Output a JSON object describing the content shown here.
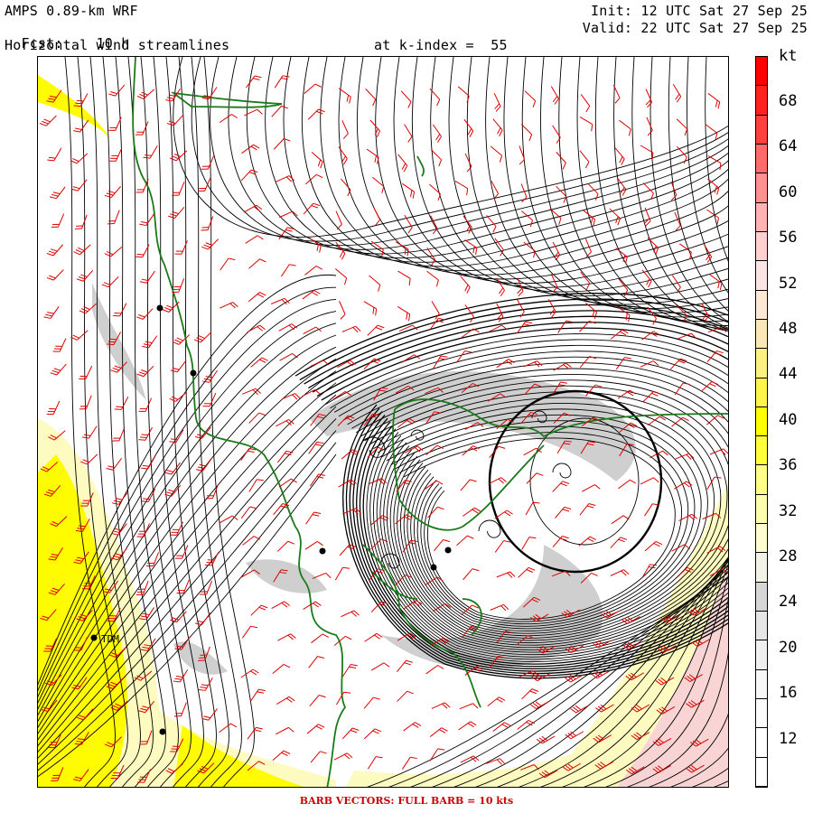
{
  "header": {
    "model": "AMPS 0.89-km WRF",
    "fcst_label": "Fcst:",
    "fcst_value": "10 h",
    "product": "Horizontal wind streamlines",
    "level": "at k-index =  55",
    "init": "Init: 12 UTC Sat 27 Sep 25",
    "valid": "Valid: 22 UTC Sat 27 Sep 25"
  },
  "map": {
    "station_label": "TDM",
    "colors": {
      "coastline": "#1a7a1a",
      "barbs": "#dd0000",
      "streamlines": "#000000",
      "gray": "#cfcfcf",
      "yellow": "#fffb00",
      "pale_yellow": "#fdfbc0",
      "pink": "#f9d4d4"
    }
  },
  "colorbar": {
    "unit": "kt",
    "labels": [
      "68",
      "64",
      "60",
      "56",
      "52",
      "48",
      "44",
      "40",
      "36",
      "32",
      "28",
      "24",
      "20",
      "16",
      "12"
    ],
    "colors": [
      "#ff0000",
      "#ff2020",
      "#ff4040",
      "#ff6a6a",
      "#ff9090",
      "#ffb3b3",
      "#ffd0d0",
      "#fbe4e4",
      "#fde9d4",
      "#fbe7b8",
      "#fcf080",
      "#fff44a",
      "#ffff00",
      "#ffff3a",
      "#ffff88",
      "#fdfdb0",
      "#fdfdd0",
      "#f2f2e6",
      "#d6d6d6",
      "#e6e6e6",
      "#efefef",
      "#f7f7f7",
      "#fbfbfb",
      "#ffffff",
      "#ffffff"
    ]
  },
  "footer": {
    "text": "BARB VECTORS:  FULL BARB = 10 kts"
  }
}
